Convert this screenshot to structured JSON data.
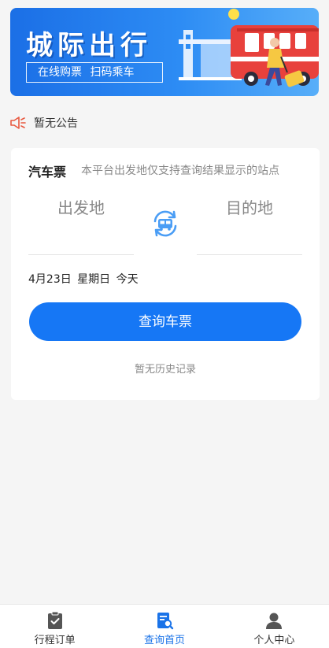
{
  "banner": {
    "title": "城际出行",
    "subtitle": "在线购票  扫码乘车"
  },
  "notice": {
    "icon": "megaphone-icon",
    "text": "暂无公告"
  },
  "search": {
    "ticket_type": "汽车票",
    "hint": "本平台出发地仅支持查询结果显示的站点",
    "from_placeholder": "出发地",
    "to_placeholder": "目的地",
    "swap_icon": "bus-swap-icon",
    "date_text": "4月23日 星期日 今天",
    "button_label": "查询车票",
    "history_text": "暂无历史记录"
  },
  "tabbar": {
    "items": [
      {
        "label": "行程订单",
        "icon": "clipboard-check-icon",
        "active": false
      },
      {
        "label": "查询首页",
        "icon": "search-document-icon",
        "active": true
      },
      {
        "label": "个人中心",
        "icon": "user-icon",
        "active": false
      }
    ]
  },
  "colors": {
    "primary": "#1677f5",
    "tab_active": "#1a73e8",
    "tab_inactive_icon": "#555555",
    "notice_icon": "#e8583f"
  }
}
